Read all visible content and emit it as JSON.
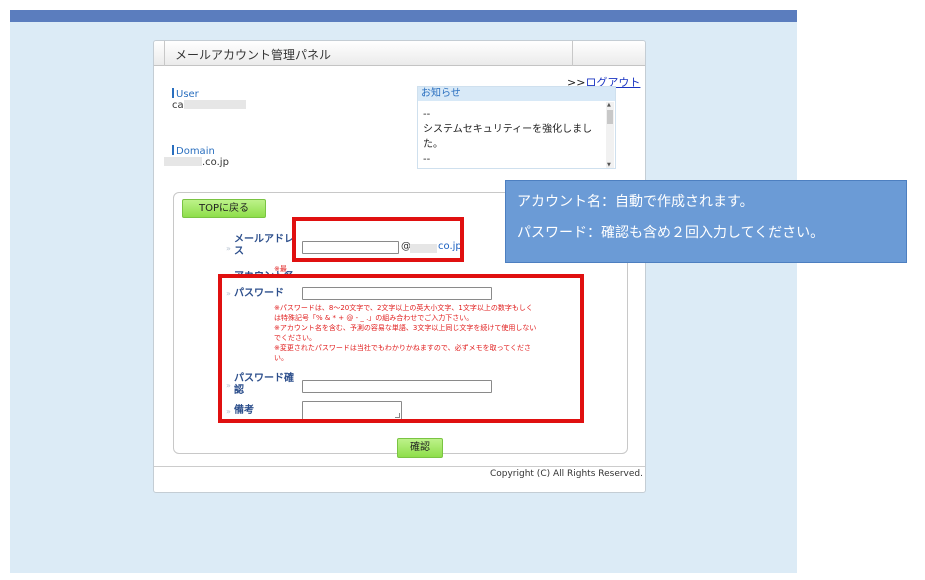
{
  "panel": {
    "title": "メールアカウント管理パネル",
    "logout_prefix": ">>",
    "logout_label": "ログアウト"
  },
  "user": {
    "label": "User",
    "value_prefix": "ca"
  },
  "domain": {
    "label": "Domain",
    "value_suffix": ".co.jp"
  },
  "news": {
    "title": "お知らせ",
    "lines": [
      "--",
      "システムセキュリティーを強化しまし",
      "た。",
      "--"
    ]
  },
  "form": {
    "top_button": "TOPに戻る",
    "mail_label_1": "メールアドレ",
    "mail_label_2": "ス",
    "mail_at": "@",
    "mail_suffix": "co.jp",
    "mail_note": "※最",
    "account_label": "アカウント名",
    "password_label": "パスワード",
    "password_notes": [
      "※パスワードは、8～20文字で、2文字以上の英大小文字、1文字以上の数字もしく",
      "は特殊記号「% & * + @ - _ .」の組み合わせでご入力下さい。",
      "※アカウント名を含む、予測の容易な単語、3文字以上同じ文字を続けて使用しない",
      "でください。",
      "※変更されたパスワードは当社でもわかりかねますので、必ずメモを取ってくださ",
      "い。"
    ],
    "password_confirm_label_1": "パスワード確",
    "password_confirm_label_2": "認",
    "remarks_label": "備考",
    "confirm_button": "確認"
  },
  "footer": {
    "copyright": "Copyright (C) All Rights Reserved."
  },
  "callout": {
    "line1": "アカウント名：自動で作成されます。",
    "line2": "パスワード：確認も含め２回入力してください。"
  },
  "colors": {
    "accent": "#5b7dbe",
    "background": "#dcebf6",
    "highlight_border": "#e01010",
    "callout_bg": "#6b9bd6",
    "button_green": "#8ede4a"
  }
}
